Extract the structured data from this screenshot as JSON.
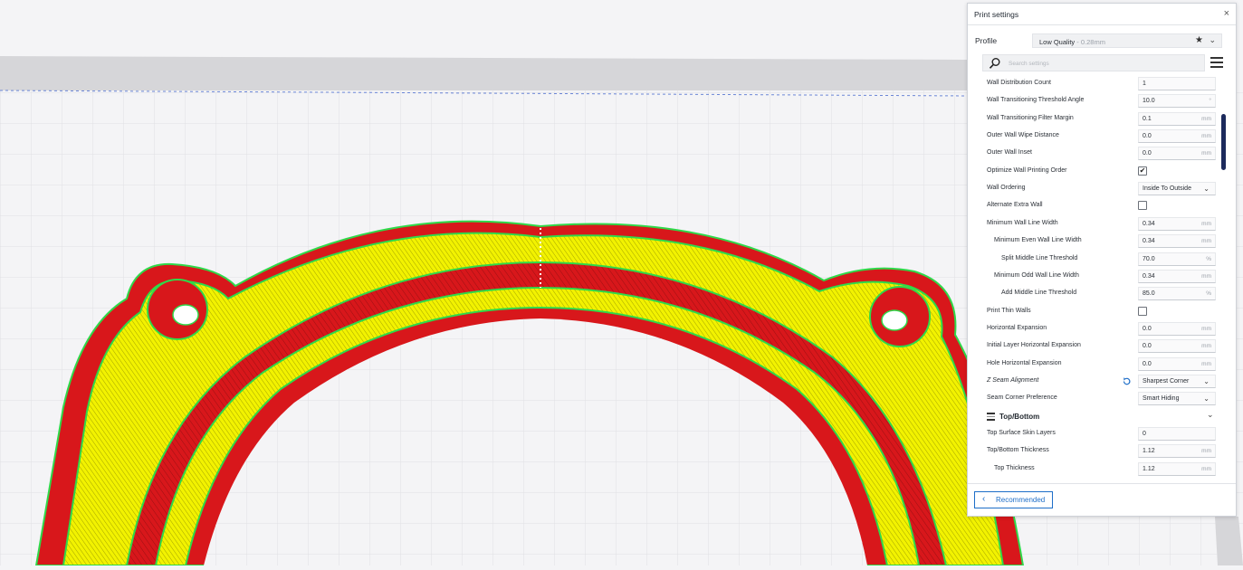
{
  "panel": {
    "title": "Print settings",
    "close_glyph": "×",
    "profile": {
      "label": "Profile",
      "quality": "Low Quality",
      "layer_height": " - 0.28mm",
      "star_glyph": "★",
      "chevron_glyph": "⌄"
    },
    "search": {
      "placeholder": "Search settings"
    },
    "settings": [
      {
        "label": "Wall Distribution Count",
        "value": "1",
        "unit": "",
        "indent": 0
      },
      {
        "label": "Wall Transitioning Threshold Angle",
        "value": "10.0",
        "unit": "°",
        "indent": 0
      },
      {
        "label": "Wall Transitioning Filter Margin",
        "value": "0.1",
        "unit": "mm",
        "indent": 0
      },
      {
        "label": "Outer Wall Wipe Distance",
        "value": "0.0",
        "unit": "mm",
        "indent": 0
      },
      {
        "label": "Outer Wall Inset",
        "value": "0.0",
        "unit": "mm",
        "indent": 0
      },
      {
        "label": "Optimize Wall Printing Order",
        "checkbox": true,
        "checked": true,
        "indent": 0
      },
      {
        "label": "Wall Ordering",
        "dropdown": "Inside To Outside",
        "indent": 0
      },
      {
        "label": "Alternate Extra Wall",
        "checkbox": true,
        "checked": false,
        "indent": 0
      },
      {
        "label": "Minimum Wall Line Width",
        "value": "0.34",
        "unit": "mm",
        "indent": 0
      },
      {
        "label": "Minimum Even Wall Line Width",
        "value": "0.34",
        "unit": "mm",
        "indent": 1
      },
      {
        "label": "Split Middle Line Threshold",
        "value": "70.0",
        "unit": "%",
        "indent": 2
      },
      {
        "label": "Minimum Odd Wall Line Width",
        "value": "0.34",
        "unit": "mm",
        "indent": 1
      },
      {
        "label": "Add Middle Line Threshold",
        "value": "85.0",
        "unit": "%",
        "indent": 2
      },
      {
        "label": "Print Thin Walls",
        "checkbox": true,
        "checked": false,
        "indent": 0
      },
      {
        "label": "Horizontal Expansion",
        "value": "0.0",
        "unit": "mm",
        "indent": 0
      },
      {
        "label": "Initial Layer Horizontal Expansion",
        "value": "0.0",
        "unit": "mm",
        "indent": 0
      },
      {
        "label": "Hole Horizontal Expansion",
        "value": "0.0",
        "unit": "mm",
        "indent": 0
      },
      {
        "label": "Z Seam Alignment",
        "dropdown": "Sharpest Corner",
        "indent": 0,
        "italic": true,
        "reset": true
      },
      {
        "label": "Seam Corner Preference",
        "dropdown": "Smart Hiding",
        "indent": 0
      },
      {
        "category": "Top/Bottom"
      },
      {
        "label": "Top Surface Skin Layers",
        "value": "0",
        "unit": "",
        "indent": 0
      },
      {
        "label": "Top/Bottom Thickness",
        "value": "1.12",
        "unit": "mm",
        "indent": 0
      },
      {
        "label": "Top Thickness",
        "value": "1.12",
        "unit": "mm",
        "indent": 1
      }
    ],
    "footer": {
      "recommended_label": "Recommended",
      "chevron_glyph": "‹"
    }
  },
  "colors": {
    "yellow_infill": "#f2f200",
    "red_wall": "#d8171b",
    "green_outline": "#2fd94a",
    "accent_blue": "#1e6ec8",
    "scroll_thumb": "#1c2a5c"
  }
}
